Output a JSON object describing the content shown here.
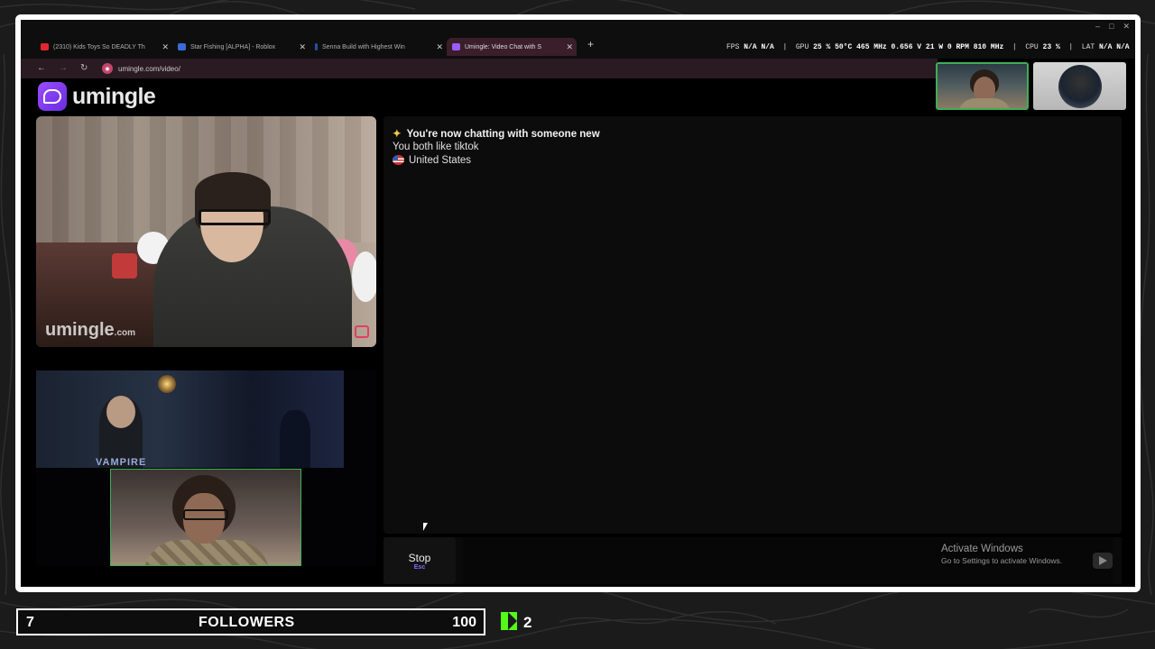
{
  "browser": {
    "tabs": [
      {
        "label": "(2310) Kids Toys So DEADLY Th",
        "icon_color": "#e0282e"
      },
      {
        "label": "Star Fishing [ALPHA] - Roblox",
        "icon_color": "#3a6bd6"
      },
      {
        "label": "Senna Build with Highest Win",
        "icon_color": "#2a4ea0"
      },
      {
        "label": "Umingle: Video Chat with S",
        "icon_color": "#9a5cff"
      }
    ],
    "active_tab_index": 3,
    "url": "umingle.com/video/",
    "window_controls": [
      "–",
      "□",
      "✕"
    ]
  },
  "overlay_stats": {
    "fps_label": "FPS",
    "fps_value": "N/A",
    "fps_value2": "N/A",
    "gpu_label": "GPU",
    "gpu_text": "25 % 50°C 465 MHz 0.656 V 21 W 0 RPM 810 MHz",
    "cpu_label": "CPU",
    "cpu_text": "23 %",
    "lat_label": "LAT",
    "lat_value": "N/A",
    "lat_value2": "N/A"
  },
  "app": {
    "logo_text": "umingle",
    "watermark": "umingle",
    "watermark_suffix": ".com"
  },
  "chat": {
    "headline": "You're now chatting with someone new",
    "interest": "You both like tiktok",
    "country": "United States"
  },
  "controls": {
    "stop_label": "Stop",
    "stop_shortcut": "Esc",
    "room_watermark": "VAMPIRE"
  },
  "windows_notice": {
    "title": "Activate Windows",
    "subtitle": "Go to Settings to activate Windows."
  },
  "follower_goal": {
    "current": "7",
    "label": "FOLLOWERS",
    "target": "100"
  },
  "kick": {
    "count": "2",
    "brand_color": "#53fc18"
  }
}
